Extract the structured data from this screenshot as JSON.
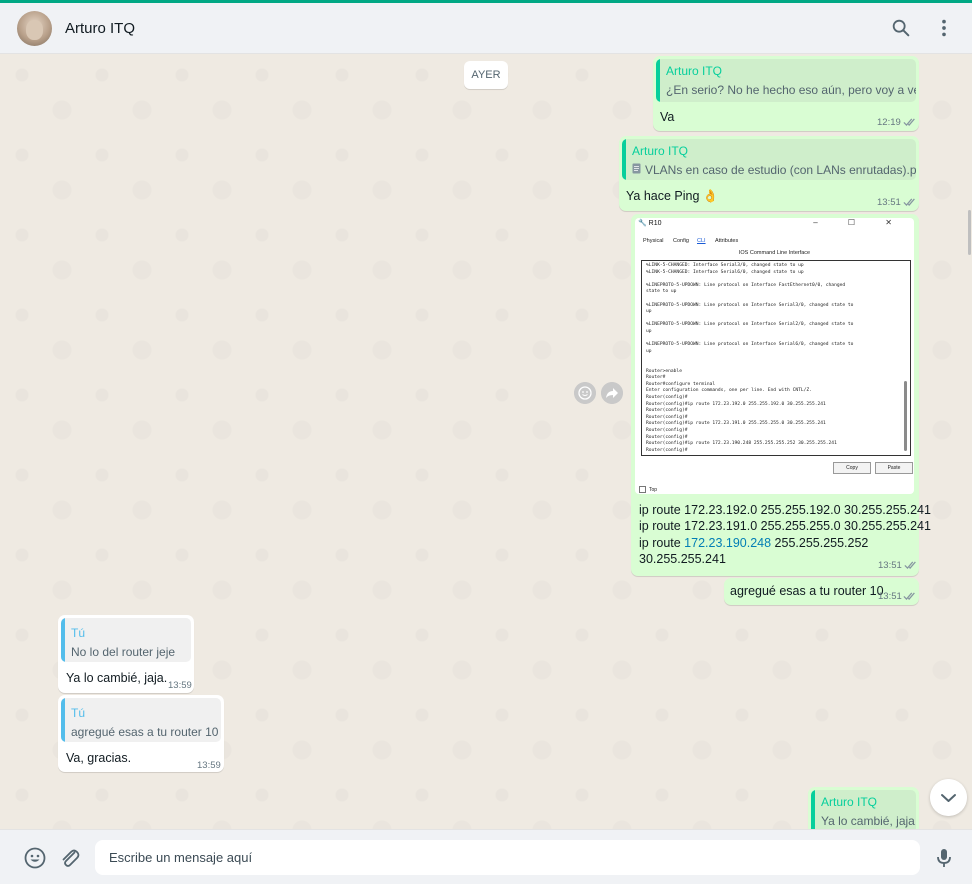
{
  "header": {
    "contact_name": "Arturo ITQ",
    "search_icon": "search-icon",
    "menu_icon": "kebab-menu-icon"
  },
  "day_separator": "AYER",
  "messages": {
    "m1": {
      "quote_name": "Arturo ITQ",
      "quote_text": "¿En serio? No he hecho eso aún, pero voy a ver.",
      "text": "Va",
      "time": "12:19"
    },
    "m2": {
      "quote_name": "Arturo ITQ",
      "quote_text": "VLANs en caso de estudio (con LANs enrutadas).pkt",
      "text": "Ya hace Ping 👌",
      "time": "13:51"
    },
    "m3": {
      "screenshot": {
        "window_title": "R10",
        "window_controls": "– ☐ ✕",
        "tabs": [
          "Physical",
          "Config",
          "CLI",
          "Attributes"
        ],
        "active_tab": "CLI",
        "cli_title": "IOS Command Line Interface",
        "cli_lines": [
          "%LINK-5-CHANGED: Interface Serial3/0, changed state to up",
          "%LINK-5-CHANGED: Interface Serial6/0, changed state to up",
          "",
          "%LINEPROTO-5-UPDOWN: Line protocol on Interface FastEthernet0/0, changed",
          "state to up",
          "",
          "%LINEPROTO-5-UPDOWN: Line protocol on Interface Serial3/0, changed state to",
          "up",
          "",
          "%LINEPROTO-5-UPDOWN: Line protocol on Interface Serial2/0, changed state to",
          "up",
          "",
          "%LINEPROTO-5-UPDOWN: Line protocol on Interface Serial6/0, changed state to",
          "up",
          "",
          "",
          "Router>enable",
          "Router#",
          "Router#configure terminal",
          "Enter configuration commands, one per line.  End with CNTL/Z.",
          "Router(config)#",
          "Router(config)#ip route 172.23.192.0 255.255.192.0 30.255.255.241",
          "Router(config)#",
          "Router(config)#",
          "Router(config)#ip route 172.23.191.0 255.255.255.0 30.255.255.241",
          "Router(config)#",
          "Router(config)#",
          "Router(config)#ip route 172.23.190.248 255.255.255.252 30.255.255.241",
          "Router(config)#"
        ],
        "copy_label": "Copy",
        "paste_label": "Paste",
        "top_label": "Top"
      },
      "line1": "ip route 172.23.192.0 255.255.192.0 30.255.255.241",
      "line2": "ip route 172.23.191.0 255.255.255.0 30.255.255.241",
      "line3_pre": "ip route ",
      "line3_link": "172.23.190.248",
      "line3_post": " 255.255.255.252",
      "line4": "30.255.255.241",
      "time": "13:51"
    },
    "m4": {
      "text": "agregué esas a tu router 10",
      "time": "13:51"
    },
    "m5": {
      "quote_name": "Tú",
      "quote_text": "No lo del router jeje",
      "text": "Ya lo cambié, jaja.",
      "time": "13:59"
    },
    "m6": {
      "quote_name": "Tú",
      "quote_text": "agregué esas a tu router 10",
      "text": "Va, gracias.",
      "time": "13:59"
    },
    "m7": {
      "quote_name": "Arturo ITQ",
      "quote_text": "Ya lo cambié, jaja."
    }
  },
  "composer": {
    "placeholder": "Escribe un mensaje aquí",
    "emoji_icon": "emoji-icon",
    "attach_icon": "paperclip-icon",
    "mic_icon": "microphone-icon"
  },
  "colors": {
    "accent": "#00a884",
    "outgoing_bubble": "#d9fdd3",
    "incoming_bubble": "#ffffff",
    "quote_other": "#06cf9c",
    "quote_self": "#53bdeb",
    "tick_read": "#53bdeb",
    "tick_grey": "#8696a0"
  }
}
